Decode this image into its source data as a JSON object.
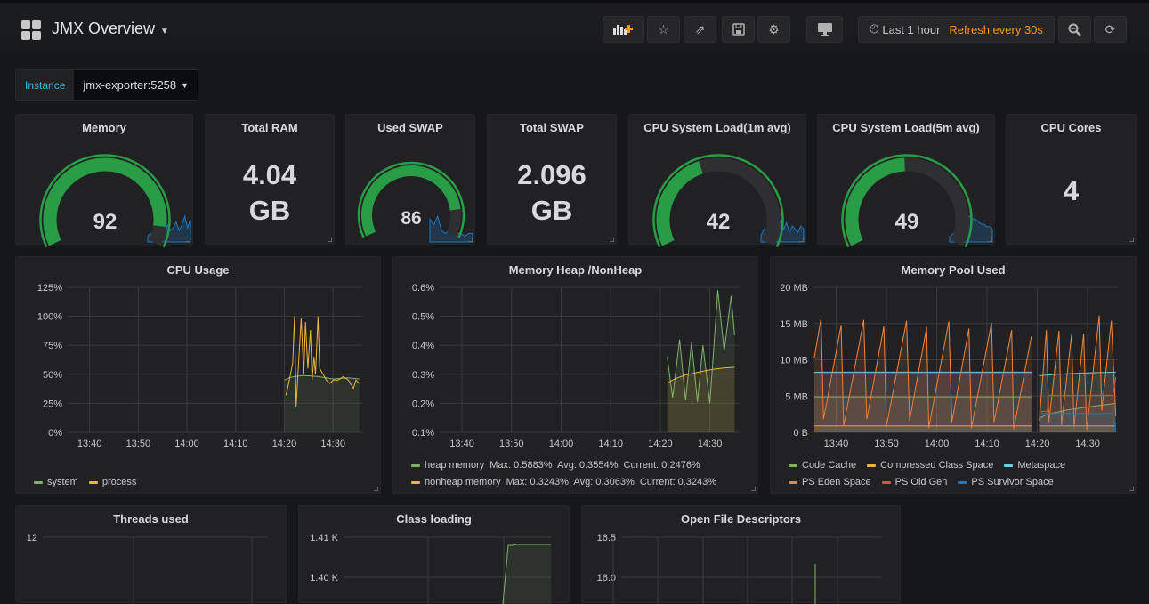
{
  "header": {
    "title": "JMX Overview",
    "buttons": [
      "add-panel",
      "star",
      "share",
      "save",
      "settings",
      "tv-mode"
    ],
    "time_range": "Last 1 hour",
    "refresh": "Refresh every 30s"
  },
  "variables": [
    {
      "label": "Instance",
      "value": "jmx-exporter:5258"
    }
  ],
  "colors": {
    "gauge_green": "#299c46",
    "sparkline_blue": "#1f78c1",
    "refresh_orange": "#f79520",
    "var_label": "#33b5e5"
  },
  "stats": [
    {
      "title": "Memory",
      "type": "gauge",
      "value": 92,
      "max": 100,
      "sparkline": [
        2,
        3,
        2,
        4,
        3,
        5,
        3,
        6,
        4,
        5,
        7,
        4,
        6,
        9,
        5,
        8
      ]
    },
    {
      "title": "Total RAM",
      "type": "value",
      "value": "4.04 GB"
    },
    {
      "title": "Used SWAP",
      "type": "gauge",
      "value": 86,
      "max": 100,
      "sparkline": [
        8,
        6,
        9,
        4,
        3,
        4,
        3,
        3,
        3,
        2,
        3,
        3
      ]
    },
    {
      "title": "Total SWAP",
      "type": "value",
      "value": "2.096 GB"
    },
    {
      "title": "CPU System Load(1m avg)",
      "type": "gauge",
      "value": 42,
      "max": 100,
      "sparkline": [
        2,
        4,
        3,
        8,
        3,
        5,
        4,
        7,
        4,
        6,
        3,
        5,
        4,
        3,
        5,
        4
      ]
    },
    {
      "title": "CPU System Load(5m avg)",
      "type": "gauge",
      "value": 49,
      "max": 100,
      "sparkline": [
        2,
        3,
        4,
        6,
        8,
        9,
        10,
        10,
        9,
        9,
        8,
        7,
        7,
        6,
        6,
        5
      ]
    },
    {
      "title": "CPU Cores",
      "type": "value",
      "value": "4"
    }
  ],
  "chart_data": [
    {
      "title": "CPU Usage",
      "type": "line",
      "xrange": [
        "13:35:30",
        "14:36:00"
      ],
      "xticks": [
        "13:40",
        "13:50",
        "14:00",
        "14:10",
        "14:20",
        "14:30"
      ],
      "ylim": [
        0,
        125
      ],
      "yticks": [
        "0%",
        "25%",
        "50%",
        "75%",
        "100%",
        "125%"
      ],
      "yvals": [
        0,
        25,
        50,
        75,
        100,
        125
      ],
      "grid": true,
      "legend": "bottom",
      "series": [
        {
          "name": "system",
          "color": "#7eb26d",
          "fill": true,
          "points": [
            [
              "14:20:00",
              45
            ],
            [
              "14:21:00",
              47
            ],
            [
              "14:22:00",
              48
            ],
            [
              "14:24:00",
              49
            ],
            [
              "14:27:00",
              48
            ],
            [
              "14:30:00",
              46
            ],
            [
              "14:33:00",
              47
            ],
            [
              "14:35:24",
              46
            ]
          ]
        },
        {
          "name": "process",
          "color": "#eab839",
          "fill": false,
          "points": [
            [
              "14:20:21",
              32
            ],
            [
              "14:21:02",
              45
            ],
            [
              "14:21:44",
              60
            ],
            [
              "14:22:05",
              100
            ],
            [
              "14:22:25",
              22
            ],
            [
              "14:22:56",
              60
            ],
            [
              "14:23:28",
              98
            ],
            [
              "14:23:59",
              50
            ],
            [
              "14:24:20",
              95
            ],
            [
              "14:24:50",
              55
            ],
            [
              "14:25:22",
              88
            ],
            [
              "14:25:43",
              45
            ],
            [
              "14:26:04",
              65
            ],
            [
              "14:26:24",
              50
            ],
            [
              "14:26:55",
              100
            ],
            [
              "14:27:16",
              55
            ],
            [
              "14:27:58",
              50
            ],
            [
              "14:28:39",
              45
            ],
            [
              "14:29:20",
              42
            ],
            [
              "14:30:02",
              45
            ],
            [
              "14:31:04",
              45
            ],
            [
              "14:32:07",
              48
            ],
            [
              "14:33:09",
              45
            ],
            [
              "14:34:11",
              38
            ],
            [
              "14:34:42",
              45
            ],
            [
              "14:35:24",
              42
            ]
          ]
        }
      ]
    },
    {
      "title": "Memory Heap /NonHeap",
      "type": "line",
      "xrange": [
        "13:35:30",
        "14:36:00"
      ],
      "xticks": [
        "13:40",
        "13:50",
        "14:00",
        "14:10",
        "14:20",
        "14:30"
      ],
      "ylim": [
        0.1,
        0.6
      ],
      "yticks": [
        "0.1%",
        "0.2%",
        "0.3%",
        "0.4%",
        "0.5%",
        "0.6%"
      ],
      "yvals": [
        0.1,
        0.2,
        0.3,
        0.4,
        0.5,
        0.6
      ],
      "grid": true,
      "legend": "bottom",
      "series": [
        {
          "name": "heap memory",
          "color": "#7eb26d",
          "fill": true,
          "stats": "Max: 0.5883%  Avg: 0.3554%  Current: 0.2476%",
          "points": [
            [
              "14:21:24",
              0.36
            ],
            [
              "14:22:30",
              0.22
            ],
            [
              "14:23:54",
              0.42
            ],
            [
              "14:25:06",
              0.21
            ],
            [
              "14:26:18",
              0.41
            ],
            [
              "14:27:30",
              0.205
            ],
            [
              "14:28:36",
              0.4
            ],
            [
              "14:30:00",
              0.2
            ],
            [
              "14:31:36",
              0.59
            ],
            [
              "14:32:54",
              0.38
            ],
            [
              "14:34:18",
              0.57
            ],
            [
              "14:35:00",
              0.435
            ]
          ]
        },
        {
          "name": "nonheap memory",
          "color": "#eab839",
          "fill": true,
          "stats": "Max: 0.3243%  Avg: 0.3063%  Current: 0.3243%",
          "points": [
            [
              "14:21:24",
              0.27
            ],
            [
              "14:23:00",
              0.285
            ],
            [
              "14:25:00",
              0.297
            ],
            [
              "14:27:00",
              0.305
            ],
            [
              "14:29:00",
              0.312
            ],
            [
              "14:31:00",
              0.318
            ],
            [
              "14:33:00",
              0.322
            ],
            [
              "14:35:00",
              0.3243
            ]
          ]
        }
      ]
    },
    {
      "title": "Memory Pool Used",
      "type": "line",
      "xrange": [
        "13:35:30",
        "14:36:00"
      ],
      "xticks": [
        "13:40",
        "13:50",
        "14:00",
        "14:10",
        "14:20",
        "14:30"
      ],
      "ylim": [
        0,
        20
      ],
      "yticks": [
        "0 B",
        "5 MB",
        "10 MB",
        "15 MB",
        "20 MB"
      ],
      "yvals": [
        0,
        5,
        10,
        15,
        20
      ],
      "grid": true,
      "legend": "bottom",
      "series": [
        {
          "name": "Code Cache",
          "color": "#7eb26d",
          "fill": true,
          "points": [
            [
              "13:35:40",
              4.9
            ],
            [
              "14:18:50",
              4.9
            ],
            [
              "14:19:30",
              null
            ],
            [
              "14:20:20",
              1.9
            ],
            [
              "14:22:00",
              2.5
            ],
            [
              "14:26:00",
              3.1
            ],
            [
              "14:30:00",
              3.5
            ],
            [
              "14:35:36",
              4.0
            ]
          ]
        },
        {
          "name": "Compressed Class Space",
          "color": "#eab839",
          "fill": true,
          "points": [
            [
              "13:35:40",
              0.9
            ],
            [
              "14:18:50",
              0.9
            ],
            [
              "14:19:30",
              null
            ],
            [
              "14:20:20",
              0.9
            ],
            [
              "14:35:36",
              0.9
            ]
          ]
        },
        {
          "name": "Metaspace",
          "color": "#6ed0e0",
          "fill": true,
          "points": [
            [
              "13:35:40",
              8.3
            ],
            [
              "14:18:50",
              8.3
            ],
            [
              "14:19:30",
              null
            ],
            [
              "14:20:20",
              7.8
            ],
            [
              "14:24:00",
              8.0
            ],
            [
              "14:30:00",
              8.2
            ],
            [
              "14:35:36",
              8.3
            ]
          ]
        },
        {
          "name": "PS Eden Space",
          "color": "#ef843c",
          "fill": true,
          "points": [
            [
              "13:35:40",
              10.3
            ],
            [
              "13:37:00",
              15.7
            ],
            [
              "13:37:30",
              1.8
            ],
            [
              "13:41:00",
              14.8
            ],
            [
              "13:41:30",
              0.9
            ],
            [
              "13:45:30",
              15.5
            ],
            [
              "13:46:06",
              1.8
            ],
            [
              "13:49:30",
              14.6
            ],
            [
              "13:50:00",
              0.8
            ],
            [
              "13:54:00",
              15.4
            ],
            [
              "13:54:36",
              1.6
            ],
            [
              "13:58:00",
              14.5
            ],
            [
              "13:58:24",
              0.6
            ],
            [
              "14:02:24",
              15.3
            ],
            [
              "14:03:00",
              1.4
            ],
            [
              "14:06:24",
              14.3
            ],
            [
              "14:06:54",
              0.6
            ],
            [
              "14:10:54",
              15.1
            ],
            [
              "14:11:24",
              1.4
            ],
            [
              "14:14:54",
              14.1
            ],
            [
              "14:15:18",
              0.4
            ],
            [
              "14:18:48",
              13.2
            ],
            [
              "14:19:30",
              null
            ],
            [
              "14:20:24",
              1.6
            ],
            [
              "14:21:48",
              14.1
            ],
            [
              "14:22:18",
              1.4
            ],
            [
              "14:24:18",
              14.0
            ],
            [
              "14:24:48",
              1.0
            ],
            [
              "14:26:48",
              13.5
            ],
            [
              "14:27:18",
              0.7
            ],
            [
              "14:29:12",
              13.6
            ],
            [
              "14:29:48",
              0.3
            ],
            [
              "14:32:18",
              16.1
            ],
            [
              "14:32:48",
              3.0
            ],
            [
              "14:34:42",
              15.4
            ],
            [
              "14:35:36",
              2.2
            ]
          ]
        },
        {
          "name": "PS Old Gen",
          "color": "#e24d42",
          "fill": true,
          "points": [
            [
              "13:35:40",
              8.1
            ],
            [
              "14:18:50",
              8.1
            ],
            [
              "14:19:30",
              null
            ],
            [
              "14:20:20",
              2.9
            ],
            [
              "14:22:00",
              2.9
            ],
            [
              "14:22:06",
              5.1
            ],
            [
              "14:35:00",
              5.1
            ],
            [
              "14:35:36",
              7.6
            ]
          ]
        },
        {
          "name": "PS Survivor Space",
          "color": "#1f78c1",
          "fill": true,
          "points": [
            [
              "13:35:40",
              0.2
            ],
            [
              "14:18:50",
              0.2
            ],
            [
              "14:19:30",
              null
            ],
            [
              "14:20:20",
              2.6
            ],
            [
              "14:35:00",
              2.6
            ],
            [
              "14:35:36",
              0.1
            ]
          ]
        }
      ]
    }
  ],
  "bottom_panels": [
    {
      "title": "Threads used",
      "yticks": [
        "12"
      ]
    },
    {
      "title": "Class loading",
      "yticks": [
        "1.41 K",
        "1.40 K"
      ]
    },
    {
      "title": "Open File Descriptors",
      "yticks": [
        "16.5",
        "16.0"
      ]
    }
  ]
}
